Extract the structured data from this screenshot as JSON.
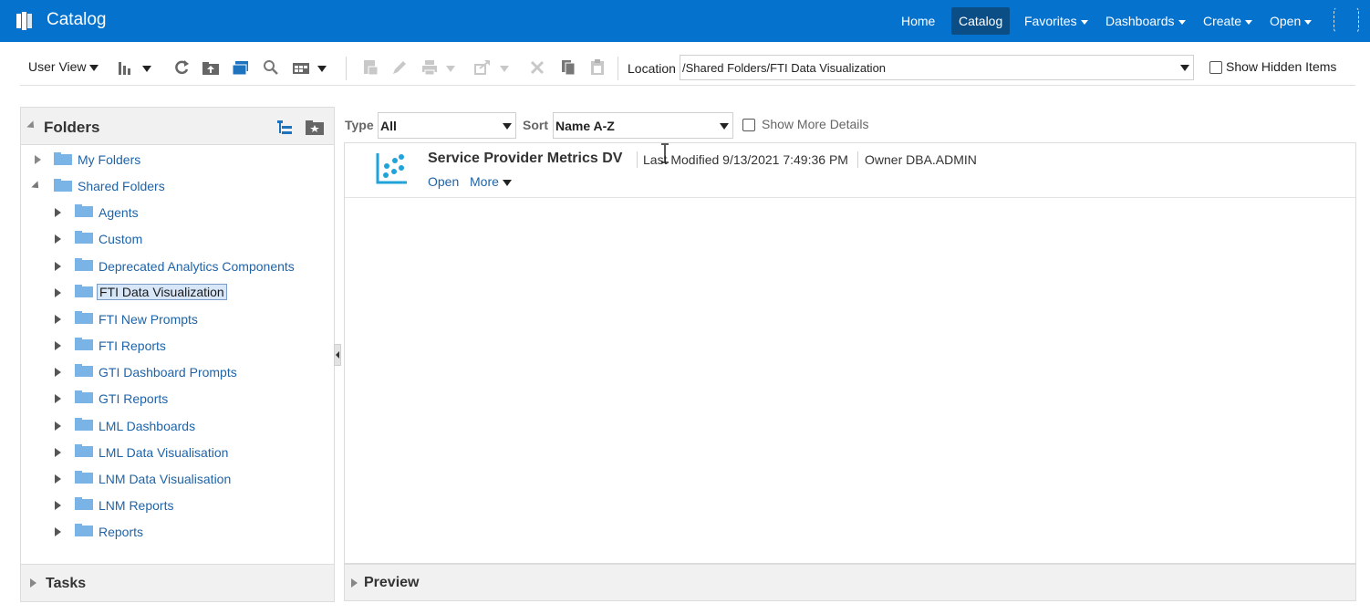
{
  "header": {
    "app_title": "Catalog",
    "nav": [
      {
        "label": "Home",
        "has_menu": false
      },
      {
        "label": "Catalog",
        "has_menu": false,
        "active": true
      },
      {
        "label": "Favorites",
        "has_menu": true
      },
      {
        "label": "Dashboards",
        "has_menu": true
      },
      {
        "label": "Create",
        "has_menu": true
      },
      {
        "label": "Open",
        "has_menu": true
      }
    ],
    "accent_color": "#0572ce"
  },
  "toolbar": {
    "view_label": "User View",
    "location_label": "Location",
    "location_value": "/Shared Folders/FTI Data Visualization",
    "show_hidden_label": "Show Hidden Items",
    "show_hidden_checked": false,
    "icons": [
      "bar-chart-icon",
      "refresh-icon",
      "upload-icon",
      "folder-icon",
      "search-icon",
      "view-mode-icon",
      "properties-icon",
      "edit-icon",
      "print-icon",
      "share-icon",
      "delete-icon",
      "copy-icon",
      "paste-icon"
    ]
  },
  "folders_pane": {
    "title": "Folders",
    "tree": [
      {
        "label": "My Folders",
        "level": 0,
        "expanded": false
      },
      {
        "label": "Shared Folders",
        "level": 0,
        "expanded": true
      },
      {
        "label": "Agents",
        "level": 1
      },
      {
        "label": "Custom",
        "level": 1
      },
      {
        "label": "Deprecated Analytics Components",
        "level": 1
      },
      {
        "label": "FTI Data Visualization",
        "level": 1,
        "selected": true
      },
      {
        "label": "FTI New Prompts",
        "level": 1
      },
      {
        "label": "FTI Reports",
        "level": 1
      },
      {
        "label": "GTI Dashboard Prompts",
        "level": 1
      },
      {
        "label": "GTI Reports",
        "level": 1
      },
      {
        "label": "LML Dashboards",
        "level": 1
      },
      {
        "label": "LML Data Visualisation",
        "level": 1
      },
      {
        "label": "LNM Data Visualisation",
        "level": 1
      },
      {
        "label": "LNM Reports",
        "level": 1
      },
      {
        "label": "Reports",
        "level": 1
      }
    ]
  },
  "tasks_pane": {
    "title": "Tasks"
  },
  "filters": {
    "type_label": "Type",
    "type_value": "All",
    "sort_label": "Sort",
    "sort_value": "Name A-Z",
    "show_more_label": "Show More Details",
    "show_more_checked": false
  },
  "results": [
    {
      "title": "Service Provider Metrics DV",
      "last_modified_label": "Last Modified",
      "last_modified_value": "9/13/2021 7:49:36 PM",
      "owner_label": "Owner",
      "owner_value": "DBA.ADMIN",
      "open_label": "Open",
      "more_label": "More",
      "icon": "data-visualization-icon"
    }
  ],
  "preview_pane": {
    "title": "Preview"
  }
}
